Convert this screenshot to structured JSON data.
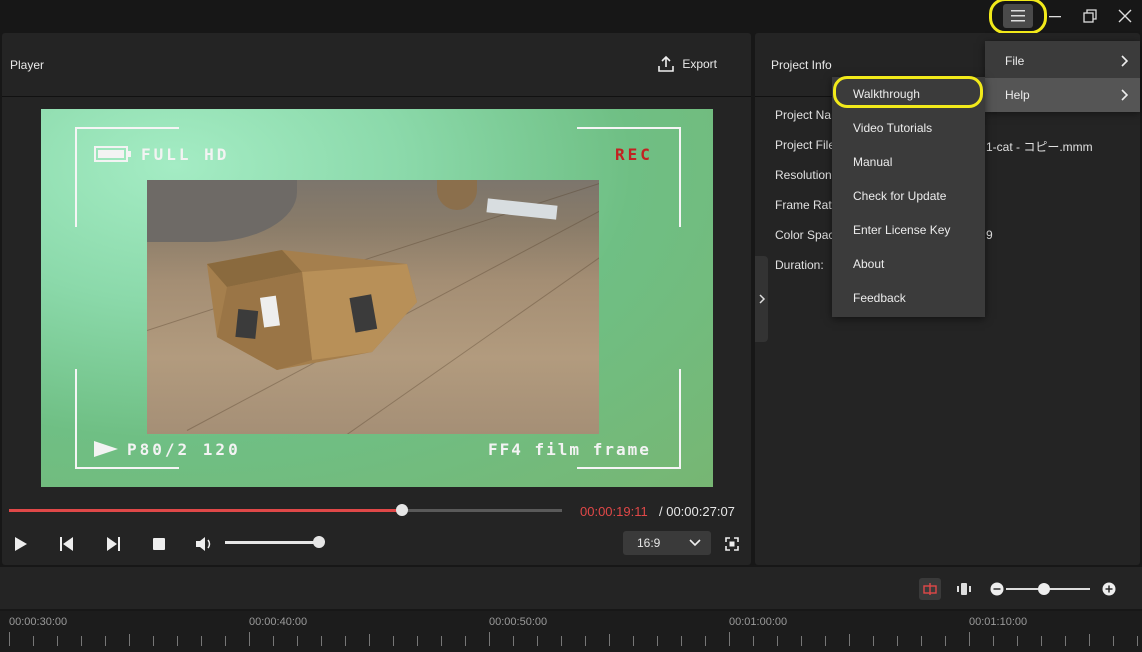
{
  "window": {
    "menu_icon": "hamburger-menu-icon",
    "minimize_icon": "minimize-icon",
    "restore_icon": "restore-icon",
    "close_icon": "close-icon"
  },
  "player": {
    "title": "Player",
    "export_label": "Export",
    "overlay": {
      "top_left": "FULL HD",
      "top_right": "REC",
      "bottom_left": "P80/2 120",
      "bottom_right": "FF4 film frame"
    },
    "current_time": "00:00:19:11",
    "total_time": "/ 00:00:27:07",
    "progress_fraction": 0.71,
    "volume_fraction": 0.98,
    "aspect_ratio": "16:9"
  },
  "project_info": {
    "title": "Project Info",
    "rows": [
      {
        "label": "Project Na",
        "value": "–"
      },
      {
        "label": "Project File",
        "value": "1-cat - コピー.mmm"
      },
      {
        "label": "Resolution",
        "value": ""
      },
      {
        "label": "Frame Rat",
        "value": ""
      },
      {
        "label": "Color Spac",
        "value": "9"
      },
      {
        "label": "Duration:",
        "value": ""
      }
    ]
  },
  "menu": {
    "items": [
      {
        "label": "File",
        "active": false
      },
      {
        "label": "Help",
        "active": true
      }
    ],
    "help_submenu": [
      "Walkthrough",
      "Video Tutorials",
      "Manual",
      "Check for Update",
      "Enter License Key",
      "About",
      "Feedback"
    ]
  },
  "timeline": {
    "zoom_fraction": 0.45,
    "ruler_labels": [
      "00:00:30:00",
      "00:00:40:00",
      "00:00:50:00",
      "00:01:00:00",
      "00:01:10:00"
    ]
  },
  "colors": {
    "accent_red": "#e04848",
    "highlight_yellow": "#f2ea1a",
    "panel_bg": "#242424",
    "menu_bg": "#3b3b3b"
  }
}
